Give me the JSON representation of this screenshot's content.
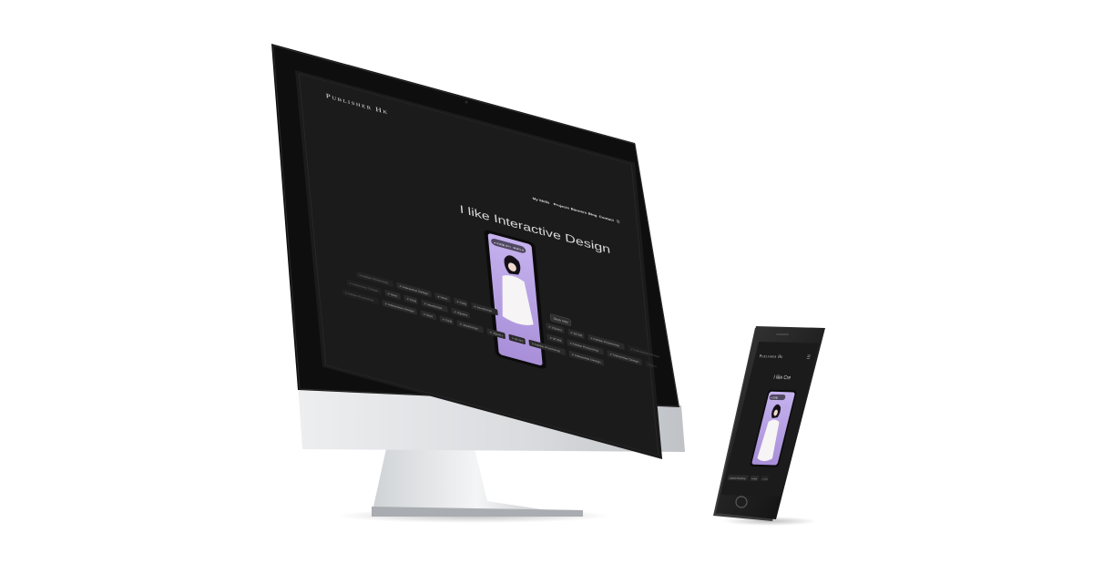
{
  "desktop": {
    "brand": "Publisher Hk",
    "nav": [
      "My Skills",
      "Projects",
      "Banners",
      "Blog",
      "Contact",
      "☰"
    ],
    "hero_title": "I like Interactive Design",
    "cta_label": "Click Me!",
    "phone_chip": "● 프로필 보기 · 퍼블리셔",
    "tag_rows": [
      [
        "# Adobe Photoshop",
        "# Interactive Design",
        "# Html",
        "# CSS",
        "# JavaScript",
        "# JQuery",
        "# SCSS",
        "# Adobe Photoshop",
        "# Interactive Design"
      ],
      [
        "# Interactive Design",
        "# Html",
        "# CSS",
        "# JavaScript",
        "# JQuery",
        "# SCSS",
        "# Adobe Photoshop",
        "# Interactive Design",
        "# Html"
      ],
      [
        "# Adobe Photoshop",
        "# Interactive Design",
        "# Html",
        "# CSS",
        "# JavaScript",
        "# JQuery",
        "# SCSS",
        "# Adobe Photoshop",
        "# Interactive Design"
      ]
    ]
  },
  "mobile": {
    "brand": "Publisher Hk",
    "menu_icon": "☰",
    "hero_title": "I like Cre",
    "chip": "● 프로필",
    "tags": [
      "# Adobe Photoshop",
      "# Html",
      "# CSS"
    ]
  },
  "colors": {
    "screen_bg": "#1b1b1b",
    "bezel": "#0e0e0e",
    "aluminum": "#d4d6d9",
    "photo_bg": "#b9a3e3",
    "tag_bg": "#2a2a2a"
  }
}
